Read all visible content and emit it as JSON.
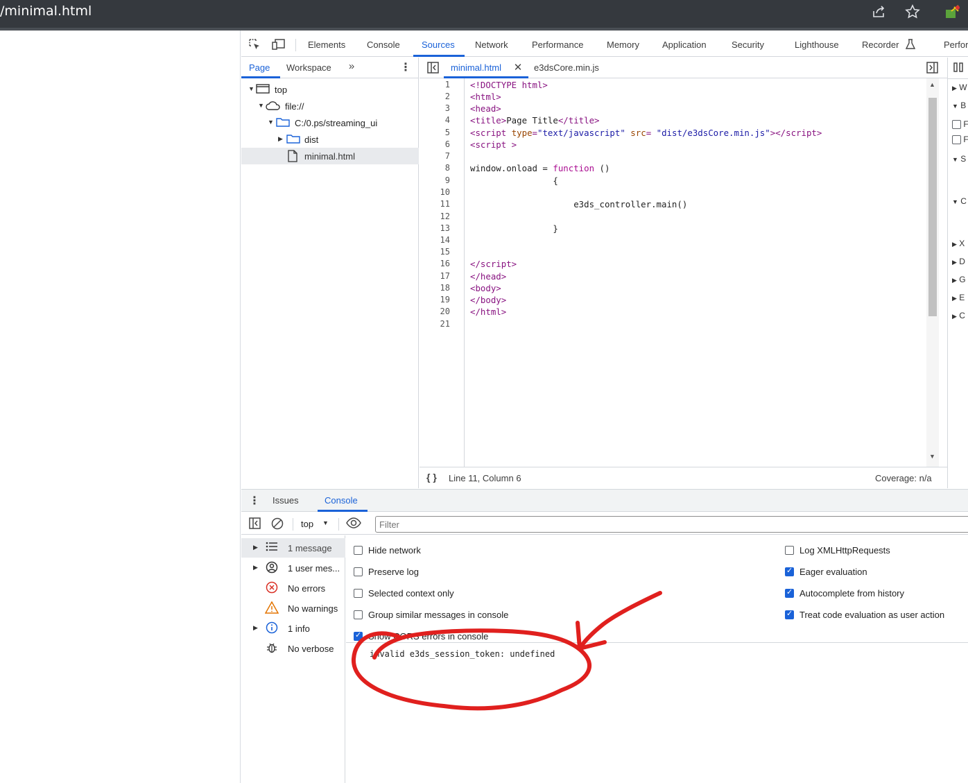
{
  "browser": {
    "url_fragment": "/minimal.html",
    "icons": [
      "share-icon",
      "star-icon",
      "extension-icon"
    ]
  },
  "devtools": {
    "tabs": [
      {
        "label": "Elements"
      },
      {
        "label": "Console"
      },
      {
        "label": "Sources"
      },
      {
        "label": "Network"
      },
      {
        "label": "Performance"
      },
      {
        "label": "Memory"
      },
      {
        "label": "Application"
      },
      {
        "label": "Security"
      },
      {
        "label": "Lighthouse"
      },
      {
        "label": "Recorder"
      },
      {
        "label": "Perfor"
      }
    ],
    "active_tab": "Sources",
    "accent_color": "#1a62d8"
  },
  "navigator": {
    "tabs": [
      {
        "label": "Page"
      },
      {
        "label": "Workspace"
      }
    ],
    "tree": [
      {
        "label": "top"
      },
      {
        "label": "file://"
      },
      {
        "label": "C:/0.ps/streaming_ui"
      },
      {
        "label": "dist"
      },
      {
        "label": "minimal.html"
      }
    ]
  },
  "editor": {
    "tabs": [
      {
        "label": "minimal.html"
      },
      {
        "label": "e3dsCore.min.js"
      }
    ],
    "line_numbers": [
      "1",
      "2",
      "3",
      "4",
      "5",
      "6",
      "7",
      "8",
      "9",
      "10",
      "11",
      "12",
      "13",
      "14",
      "15",
      "16",
      "17",
      "18",
      "19",
      "20",
      "21"
    ],
    "status_position": "Line 11, Column 6",
    "coverage": "Coverage: n/a"
  },
  "right_pane": {
    "rows": [
      "W",
      "B",
      "F",
      "F",
      "S",
      "C",
      "X",
      "D",
      "G",
      "E",
      "C"
    ]
  },
  "drawer": {
    "tabs": [
      {
        "label": "Issues"
      },
      {
        "label": "Console"
      }
    ],
    "context_select": "top",
    "filter_placeholder": "Filter",
    "sidebar": [
      {
        "label": "1 message"
      },
      {
        "label": "1 user mes..."
      },
      {
        "label": "No errors"
      },
      {
        "label": "No warnings"
      },
      {
        "label": "1 info"
      },
      {
        "label": "No verbose"
      }
    ],
    "settings_left": [
      {
        "label": "Hide network",
        "checked": false
      },
      {
        "label": "Preserve log",
        "checked": false
      },
      {
        "label": "Selected context only",
        "checked": false
      },
      {
        "label": "Group similar messages in console",
        "checked": false
      },
      {
        "label": "Show CORS errors in console",
        "checked": true
      }
    ],
    "settings_right": [
      {
        "label": "Log XMLHttpRequests",
        "checked": false
      },
      {
        "label": "Eager evaluation",
        "checked": true
      },
      {
        "label": "Autocomplete from history",
        "checked": true
      },
      {
        "label": "Treat code evaluation as user action",
        "checked": true
      }
    ],
    "console_message": "invalid e3ds_session_token: undefined",
    "annotation_color": "#e0201e"
  }
}
